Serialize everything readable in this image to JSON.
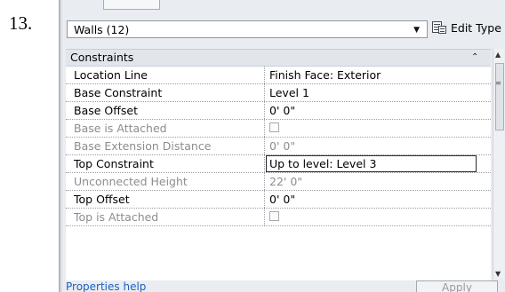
{
  "step_number": "13.",
  "type_selector": {
    "value": "Walls (12)"
  },
  "edit_type": {
    "label": "Edit Type"
  },
  "group": {
    "title": "Constraints"
  },
  "properties": [
    {
      "name": "Location Line",
      "value": "Finish Face: Exterior",
      "enabled": true,
      "kind": "text"
    },
    {
      "name": "Base Constraint",
      "value": "Level 1",
      "enabled": true,
      "kind": "text"
    },
    {
      "name": "Base Offset",
      "value": "0'  0\"",
      "enabled": true,
      "kind": "text"
    },
    {
      "name": "Base is Attached",
      "value": "",
      "enabled": false,
      "kind": "checkbox"
    },
    {
      "name": "Base Extension Distance",
      "value": "0'  0\"",
      "enabled": false,
      "kind": "text"
    },
    {
      "name": "Top Constraint",
      "value": "Up to level: Level 3",
      "enabled": true,
      "kind": "editing"
    },
    {
      "name": "Unconnected Height",
      "value": "22'  0\"",
      "enabled": false,
      "kind": "text"
    },
    {
      "name": "Top Offset",
      "value": "0'  0\"",
      "enabled": true,
      "kind": "text"
    },
    {
      "name": "Top is Attached",
      "value": "",
      "enabled": false,
      "kind": "checkbox"
    }
  ],
  "footer": {
    "help_link": "Properties help",
    "apply_label": "Apply"
  }
}
